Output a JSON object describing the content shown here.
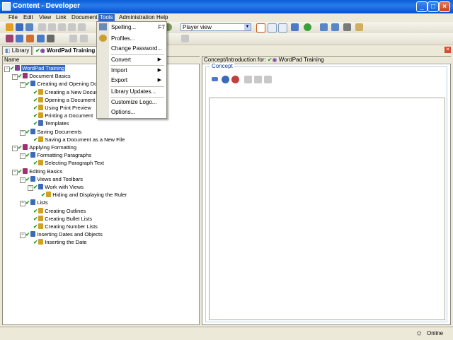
{
  "window": {
    "title": "Content - Developer"
  },
  "menubar": [
    "File",
    "Edit",
    "View",
    "Link",
    "Document",
    "Tools",
    "Administration",
    "Help"
  ],
  "toolbar": {
    "view_select": "Player view"
  },
  "tabs": [
    {
      "label": "Library"
    },
    {
      "label": "WordPad Training"
    }
  ],
  "tree": {
    "header": "Name",
    "nodes": [
      {
        "label": "WordPad Training",
        "selected": true
      },
      {
        "label": "Document Basics"
      },
      {
        "label": "Creating and Opening Doc"
      },
      {
        "label": "Creating a New Docum"
      },
      {
        "label": "Opening a Document"
      },
      {
        "label": "Using Print Preview"
      },
      {
        "label": "Printing a Document"
      },
      {
        "label": "Templates"
      },
      {
        "label": "Saving Documents"
      },
      {
        "label": "Saving a Document as a New File"
      },
      {
        "label": "Applying Formatting"
      },
      {
        "label": "Formatting Paragraphs"
      },
      {
        "label": "Selecting Paragraph Text"
      },
      {
        "label": "Editing Basics"
      },
      {
        "label": "Views and Toolbars"
      },
      {
        "label": "Work with Views"
      },
      {
        "label": "Hiding and Displaying the Ruler"
      },
      {
        "label": "Lists"
      },
      {
        "label": "Creating Outlines"
      },
      {
        "label": "Creating Bullet Lists"
      },
      {
        "label": "Creating Number Lists"
      },
      {
        "label": "Inserting Dates and Objects"
      },
      {
        "label": "Inserting the Date"
      }
    ]
  },
  "concept": {
    "header": "Concept/Introduction for:",
    "doc_title": "WordPad Training",
    "group_label": "Concept"
  },
  "tools_menu": [
    {
      "label": "Spelling...",
      "shortcut": "F7"
    },
    {
      "label": "Profiles..."
    },
    {
      "label": "Change Password..."
    },
    {
      "label": "Convert",
      "submenu": true
    },
    {
      "label": "Import",
      "submenu": true
    },
    {
      "label": "Export",
      "submenu": true
    },
    {
      "label": "Library Updates..."
    },
    {
      "label": "Customize Logo..."
    },
    {
      "label": "Options..."
    }
  ],
  "status": {
    "state": "Online"
  }
}
